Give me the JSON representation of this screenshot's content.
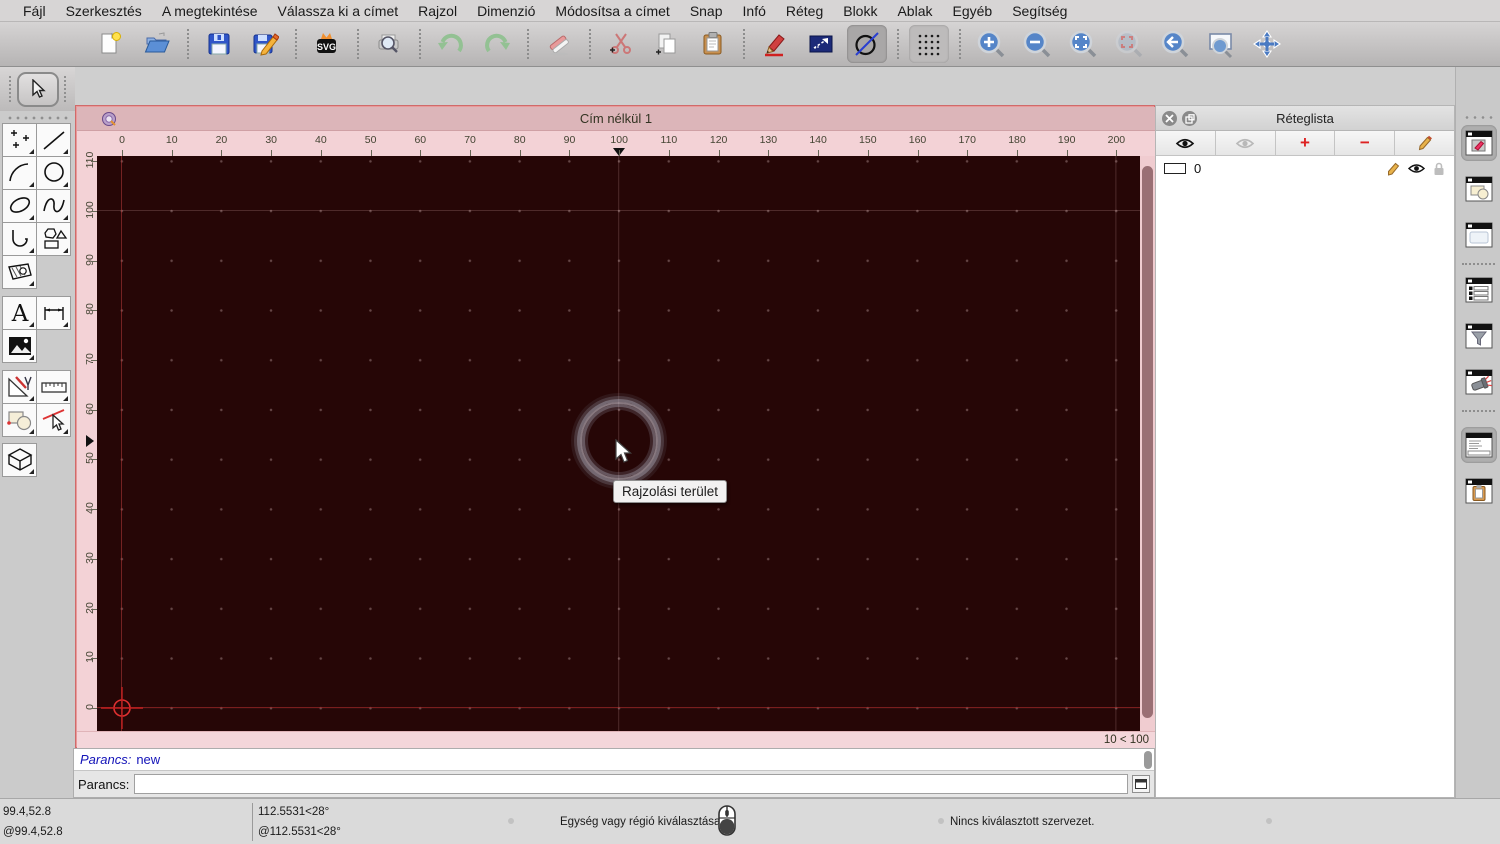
{
  "menubar": {
    "items": [
      "Fájl",
      "Szerkesztés",
      "A megtekintése",
      "Válassza ki a címet",
      "Rajzol",
      "Dimenzió",
      "Módosítsa a címet",
      "Snap",
      "Infó",
      "Réteg",
      "Blokk",
      "Ablak",
      "Egyéb",
      "Segítség"
    ]
  },
  "toolbar": {
    "svg_badge": "SVG",
    "buttons": [
      "new-document",
      "open-file",
      "save",
      "save-as",
      "export-svg",
      "print-preview",
      "undo",
      "redo",
      "delete-entity",
      "cut",
      "copy",
      "paste",
      "pen-attributes",
      "selection-window",
      "draw-circle",
      "grid-toggle",
      "zoom-in",
      "zoom-out",
      "zoom-auto",
      "zoom-selected",
      "zoom-previous",
      "zoom-window",
      "zoom-pan"
    ],
    "active_buttons": [
      "draw-circle",
      "grid-toggle"
    ]
  },
  "palette": {
    "tools": [
      "select-arrow",
      "points",
      "line",
      "arc",
      "circle",
      "ellipse",
      "spline",
      "polyline",
      "polygon-shapes",
      "hatch",
      "text",
      "dimension",
      "image",
      "modify",
      "measure",
      "order",
      "select-entity",
      "solid-3d"
    ]
  },
  "drawing_window": {
    "title": "Cím nélkül 1",
    "grid_status": "10 < 100",
    "tooltip": "Rajzolási terület"
  },
  "rulers": {
    "horizontal": [
      0,
      10,
      20,
      30,
      40,
      50,
      60,
      70,
      80,
      90,
      100,
      110,
      120,
      130,
      140,
      150,
      160,
      170,
      180,
      190,
      200
    ],
    "vertical": [
      0,
      10,
      20,
      30,
      40,
      50,
      60,
      70,
      80,
      90,
      100,
      110
    ]
  },
  "layer_panel": {
    "title": "Réteglista",
    "toolbar_icons": [
      "show-all-layers",
      "hide-all-layers",
      "add-layer",
      "remove-layer",
      "edit-layer"
    ],
    "add_glyph": "+",
    "remove_glyph": "−",
    "layers": [
      {
        "name": "0"
      }
    ]
  },
  "command_dock": {
    "history": [
      {
        "label": "Parancs:",
        "value": "new"
      }
    ],
    "prompt_label": "Parancs:",
    "input_value": "",
    "input_placeholder": ""
  },
  "statusbar": {
    "coord_abs": "99.4,52.8",
    "coord_rel": "@99.4,52.8",
    "polar_abs": "112.5531<28°",
    "polar_rel": "@112.5531<28°",
    "hint": "Egység vagy régió kiválasztása",
    "selection": "Nincs kiválasztott szervezet."
  },
  "colors": {
    "canvas_bg": "#260606",
    "window_frame": "#efc9cd",
    "ruler_bg": "#f3d2d6",
    "axis_red": "#a51919",
    "accent_blue": "#2a3fd0",
    "toolbar_gray": "#c6c4c4"
  }
}
